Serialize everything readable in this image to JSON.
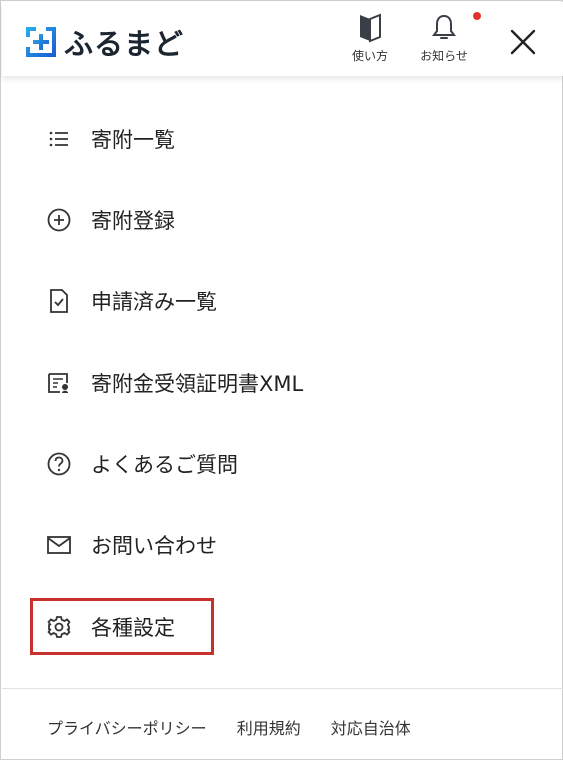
{
  "header": {
    "logo_text": "ふるまど",
    "guide_label": "使い方",
    "notify_label": "お知らせ",
    "accent_color": "#1e6fd9",
    "notify_dot_color": "#e5312b"
  },
  "menu": {
    "items": [
      {
        "label": "寄附一覧",
        "icon": "list-icon"
      },
      {
        "label": "寄附登録",
        "icon": "plus-circle-icon"
      },
      {
        "label": "申請済み一覧",
        "icon": "document-check-icon"
      },
      {
        "label": "寄附金受領証明書XML",
        "icon": "certificate-icon"
      },
      {
        "label": "よくあるご質問",
        "icon": "question-circle-icon"
      },
      {
        "label": "お問い合わせ",
        "icon": "mail-icon"
      },
      {
        "label": "各種設定",
        "icon": "gear-icon"
      }
    ],
    "highlight_color": "#c8312a"
  },
  "footer": {
    "links": [
      "プライバシーポリシー",
      "利用規約",
      "対応自治体"
    ]
  }
}
